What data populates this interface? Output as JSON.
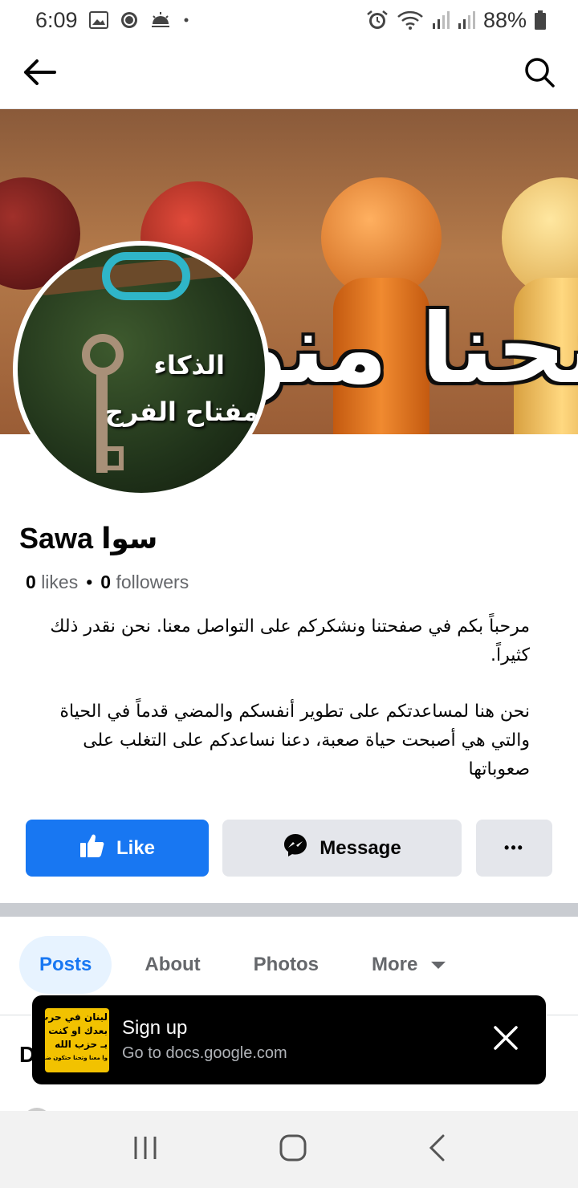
{
  "status_bar": {
    "time": "6:09",
    "battery": "88%",
    "icons_left": [
      "gallery-icon",
      "chat-bubble-icon",
      "weather-icon",
      "dot-icon"
    ],
    "icons_right": [
      "alarm-icon",
      "wifi-icon",
      "signal-icon",
      "signal-icon",
      "battery-icon"
    ]
  },
  "app_bar": {
    "back_icon": "arrow-left-icon",
    "search_icon": "search-icon"
  },
  "cover": {
    "text": "نحنا منوقف"
  },
  "avatar": {
    "line1": "الذكاء",
    "line2": "مفتاح الفرج"
  },
  "page": {
    "name": "Sawa سوا",
    "likes_count": "0",
    "likes_label": "likes",
    "separator": "•",
    "followers_count": "0",
    "followers_label": "followers",
    "bio_paragraph_1": "مرحباً بكم في صفحتنا ونشكركم على التواصل معنا. نحن نقدر ذلك كثيراً.",
    "bio_paragraph_2": "نحن هنا لمساعدتكم على تطوير أنفسكم والمضي قدماً في الحياة والتي هي أصبحت حياة صعبة، دعنا نساعدكم على التغلب على صعوباتها"
  },
  "actions": {
    "like_label": "Like",
    "message_label": "Message",
    "more_label": "•••"
  },
  "tabs": [
    {
      "label": "Posts",
      "active": true
    },
    {
      "label": "About",
      "active": false
    },
    {
      "label": "Photos",
      "active": false
    },
    {
      "label": "More",
      "active": false
    }
  ],
  "peek": {
    "letter": "D"
  },
  "snackbar": {
    "thumb_line1": "لبنان في حرب",
    "thumb_line2": "بعدك او كنت م",
    "thumb_line3": "بـ حزب الله",
    "thumb_line4": "وا معنا وتحنا حتكون ضمانا",
    "title": "Sign up",
    "subtitle": "Go to docs.google.com"
  },
  "colors": {
    "brand_blue": "#1877f2",
    "button_gray": "#e4e6eb",
    "tab_active_bg": "#e7f3ff"
  }
}
